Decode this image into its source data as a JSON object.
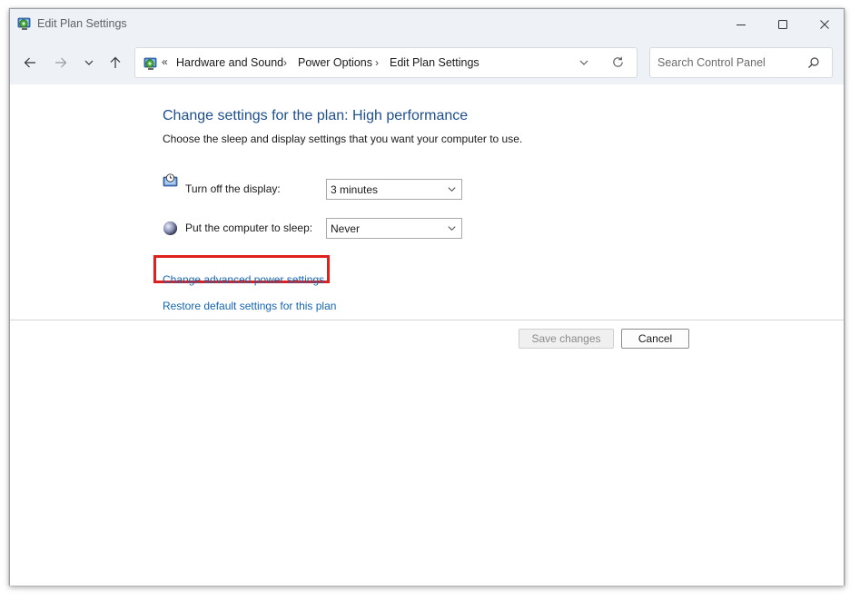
{
  "window": {
    "title": "Edit Plan Settings"
  },
  "address": {
    "overflow": "«",
    "crumbs": [
      {
        "label": "Hardware and Sound"
      },
      {
        "label": "Power Options"
      },
      {
        "label": "Edit Plan Settings"
      }
    ],
    "separator": "›"
  },
  "search": {
    "placeholder": "Search Control Panel"
  },
  "main": {
    "heading": "Change settings for the plan: High performance",
    "subheading": "Choose the sleep and display settings that you want your computer to use.",
    "settings": [
      {
        "label": "Turn off the display:",
        "value": "3 minutes",
        "icon": "display-timer-icon"
      },
      {
        "label": "Put the computer to sleep:",
        "value": "Never",
        "icon": "sleep-moon-icon"
      }
    ],
    "links": {
      "advanced": "Change advanced power settings",
      "restore": "Restore default settings for this plan"
    },
    "buttons": {
      "save": "Save changes",
      "cancel": "Cancel"
    }
  },
  "colors": {
    "heading": "#1e4f8f",
    "link": "#1565b5",
    "highlight": "#e0201c",
    "chrome": "#eef2f6"
  }
}
